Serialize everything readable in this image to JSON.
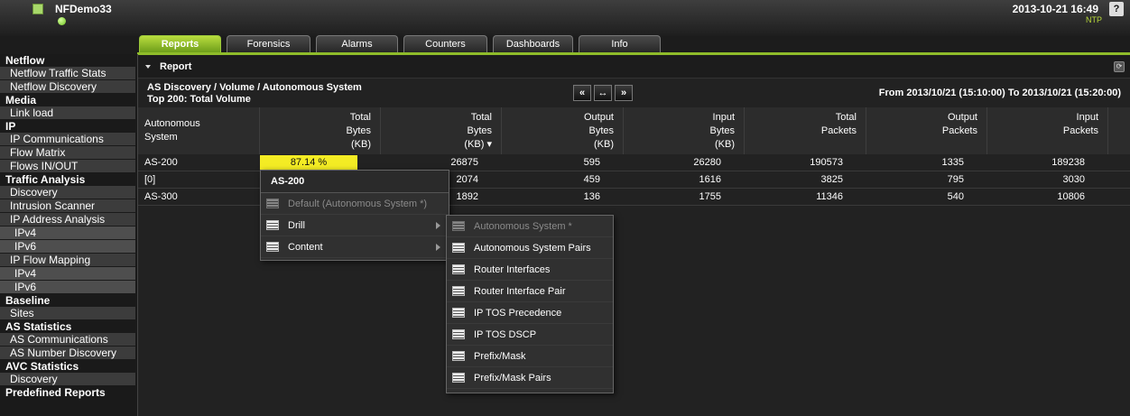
{
  "header": {
    "app_title": "NFDemo33",
    "datetime": "2013-10-21 16:49",
    "ntp": "NTP",
    "help": "?"
  },
  "tabs": [
    {
      "label": "Reports",
      "active": true
    },
    {
      "label": "Forensics"
    },
    {
      "label": "Alarms"
    },
    {
      "label": "Counters"
    },
    {
      "label": "Dashboards"
    },
    {
      "label": "Info"
    }
  ],
  "sidebar": {
    "netflow": {
      "title": "Netflow",
      "items": [
        "Netflow Traffic Stats",
        "Netflow Discovery"
      ]
    },
    "media": {
      "title": "Media",
      "items": [
        "Link load"
      ]
    },
    "ip": {
      "title": "IP",
      "items": [
        "IP Communications",
        "Flow Matrix",
        "Flows IN/OUT"
      ]
    },
    "traffic": {
      "title": "Traffic Analysis",
      "discovery": "Discovery",
      "intrusion": "Intrusion Scanner",
      "ip_analysis": "IP Address Analysis",
      "ip_analysis_subs": [
        "IPv4",
        "IPv6"
      ],
      "ip_flow": "IP Flow Mapping",
      "ip_flow_subs": [
        "IPv4",
        "IPv6"
      ]
    },
    "baseline": {
      "title": "Baseline",
      "items": [
        "Sites"
      ]
    },
    "as_stats": {
      "title": "AS Statistics",
      "items": [
        "AS Communications",
        "AS Number Discovery"
      ]
    },
    "avc": {
      "title": "AVC Statistics",
      "items": [
        "Discovery"
      ]
    },
    "predefined": {
      "title": "Predefined Reports"
    }
  },
  "report": {
    "section_title": "Report",
    "breadcrumb": "AS Discovery / Volume / Autonomous System",
    "subtitle": "Top 200: Total Volume",
    "range": "From 2013/10/21 (15:10:00) To 2013/10/21 (15:20:00)",
    "nav": {
      "prev": "«",
      "expand": "↔",
      "next": "»"
    }
  },
  "table": {
    "headers": [
      "Autonomous\nSystem",
      "Total\nBytes\n(KB)",
      "Total\nBytes\n(KB) ▾",
      "Output\nBytes\n(KB)",
      "Input\nBytes\n(KB)",
      "Total\nPackets",
      "Output\nPackets",
      "Input\nPackets"
    ],
    "rows": [
      [
        "AS-200",
        "87.14 %",
        "26875",
        "595",
        "26280",
        "190573",
        "1335",
        "189238"
      ],
      [
        "[0]",
        "",
        "2074",
        "459",
        "1616",
        "3825",
        "795",
        "3030"
      ],
      [
        "AS-300",
        "",
        "1892",
        "136",
        "1755",
        "11346",
        "540",
        "10806"
      ]
    ]
  },
  "context_menu": {
    "title": "AS-200",
    "items": [
      "Default (Autonomous System *)",
      "Drill",
      "Content"
    ]
  },
  "drill_menu": {
    "items": [
      "Autonomous System *",
      "Autonomous System Pairs",
      "Router Interfaces",
      "Router Interface Pair",
      "IP TOS Precedence",
      "IP TOS DSCP",
      "Prefix/Mask",
      "Prefix/Mask Pairs"
    ]
  },
  "colors": {
    "accent": "#8fbc2a",
    "highlight": "#f4ec24"
  }
}
